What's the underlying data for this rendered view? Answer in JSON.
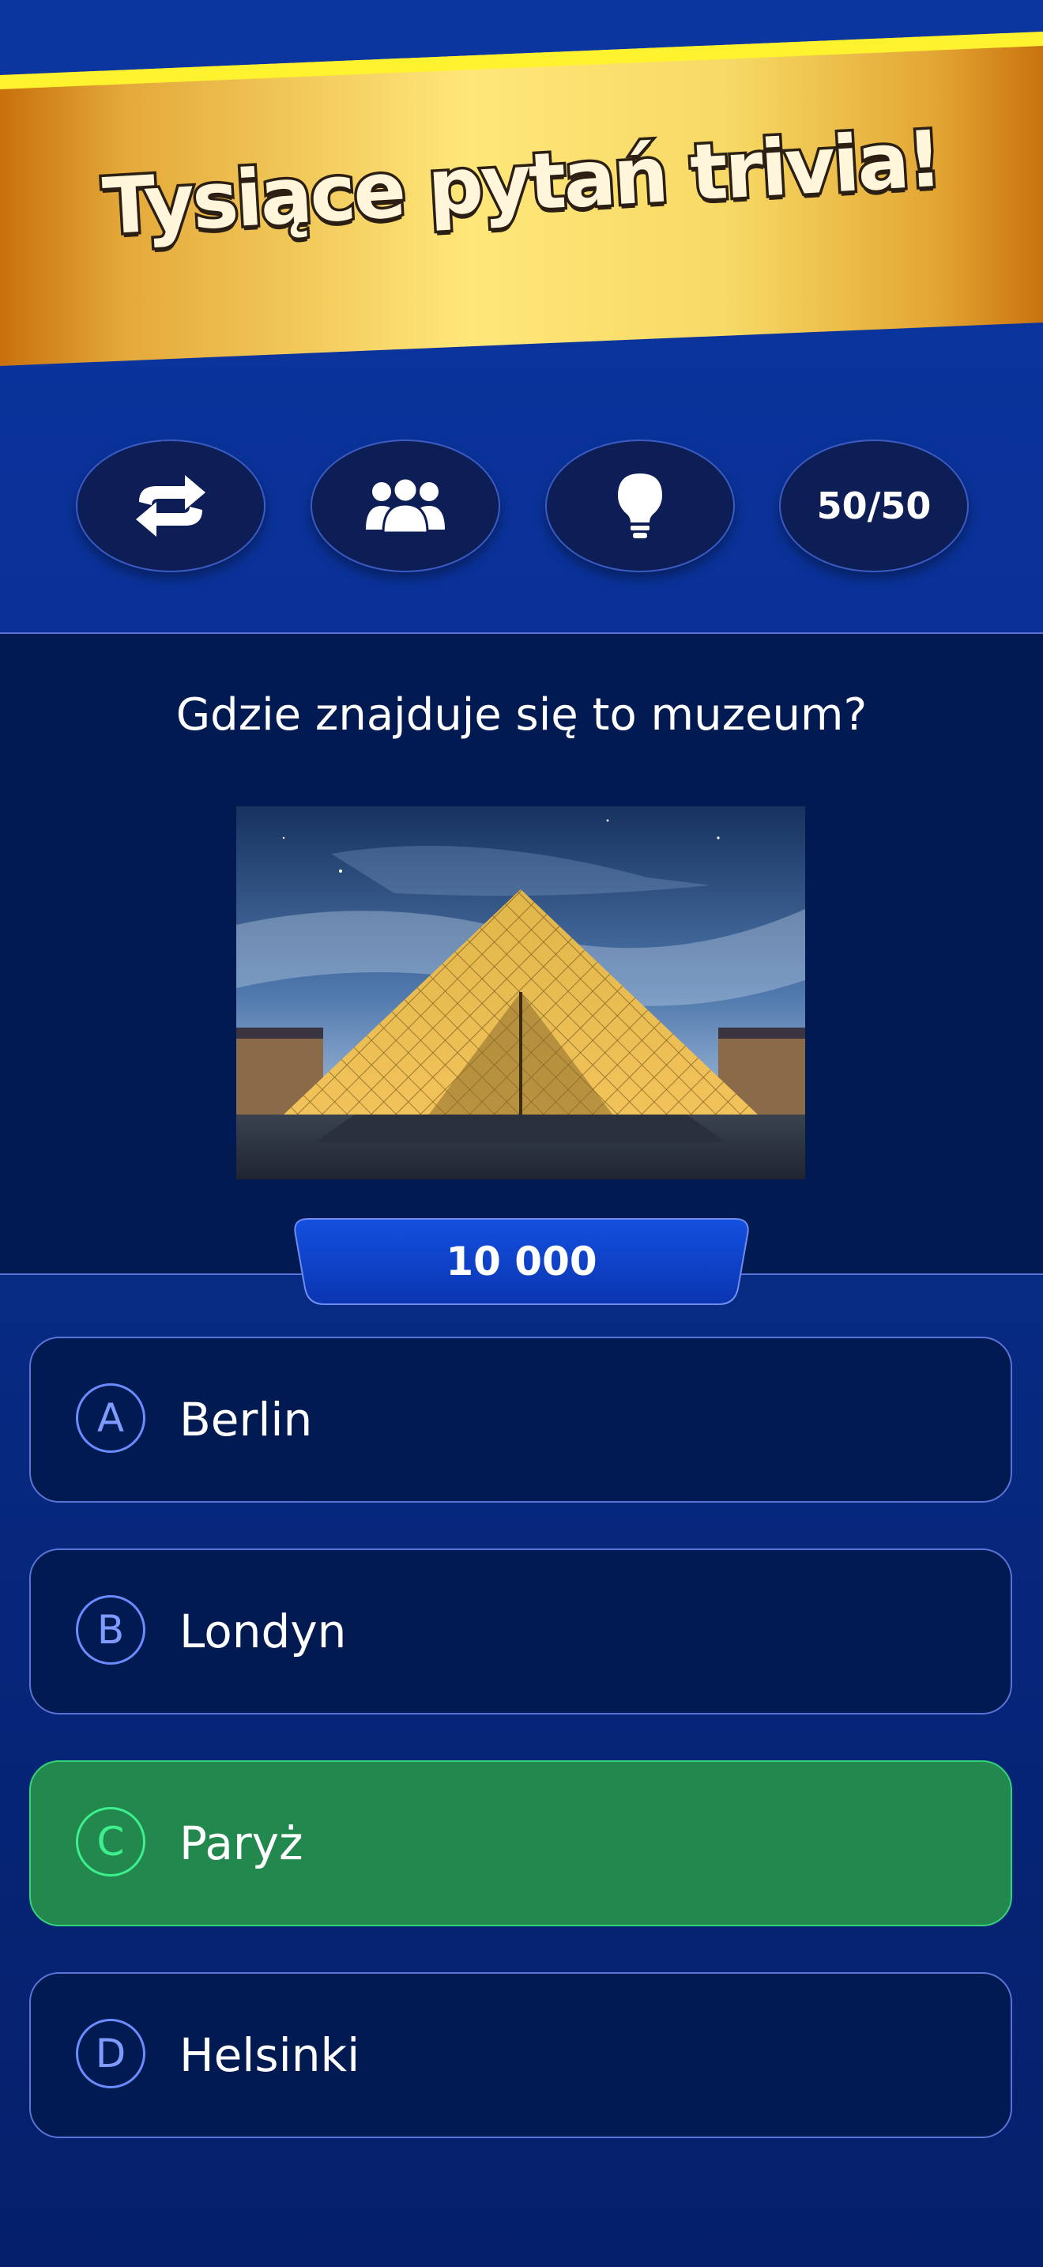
{
  "banner": {
    "title": "Tysiące pytań trivia!"
  },
  "lifelines": [
    {
      "icon": "swap-arrows-icon",
      "label": ""
    },
    {
      "icon": "audience-icon",
      "label": ""
    },
    {
      "icon": "lightbulb-icon",
      "label": ""
    },
    {
      "icon": "",
      "label": "50/50"
    }
  ],
  "question": {
    "text": "Gdzie znajduje się to muzeum?",
    "image": "louvre-pyramid-photo"
  },
  "prize": {
    "amount": "10 000"
  },
  "answers": [
    {
      "letter": "A",
      "text": "Berlin",
      "state": "default"
    },
    {
      "letter": "B",
      "text": "Londyn",
      "state": "default"
    },
    {
      "letter": "C",
      "text": "Paryż",
      "state": "correct"
    },
    {
      "letter": "D",
      "text": "Helsinki",
      "state": "default"
    }
  ],
  "colors": {
    "background": "#0a2780",
    "question_bg": "#021a52",
    "correct_answer": "#23884d",
    "correct_accent": "#3cf08e",
    "banner_gold": "#f5d35c"
  }
}
